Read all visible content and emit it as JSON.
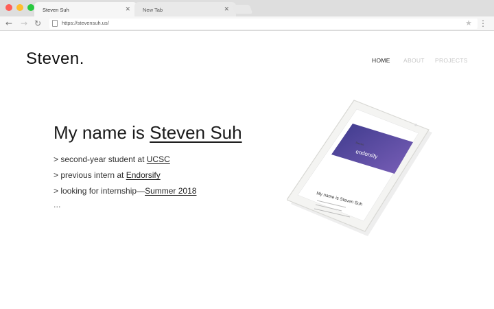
{
  "browser": {
    "tabs": [
      {
        "label": "Steven Suh",
        "active": true
      },
      {
        "label": "New Tab",
        "active": false
      }
    ],
    "url": "https://stevensuh.us/",
    "traffic_light_colors": [
      "#ff5f57",
      "#ffbd2e",
      "#28c940"
    ]
  },
  "site": {
    "logo": "Steven.",
    "nav": {
      "home": "HOME",
      "about": "ABOUT",
      "projects": "PROJECTS"
    },
    "headline": {
      "prefix": "My name is ",
      "name": "Steven Suh"
    },
    "lines": [
      {
        "prefix": "> second-year student at ",
        "link": "UCSC"
      },
      {
        "prefix": "> previous intern at ",
        "link": "Endorsify"
      },
      {
        "prefix": "> looking for internship—",
        "link": "Summer 2018"
      }
    ],
    "ellipsis": "...",
    "tablet_screen": {
      "site_name": "Steven.",
      "brand": "endorsify",
      "headline": "My name is Steven Suh"
    }
  }
}
